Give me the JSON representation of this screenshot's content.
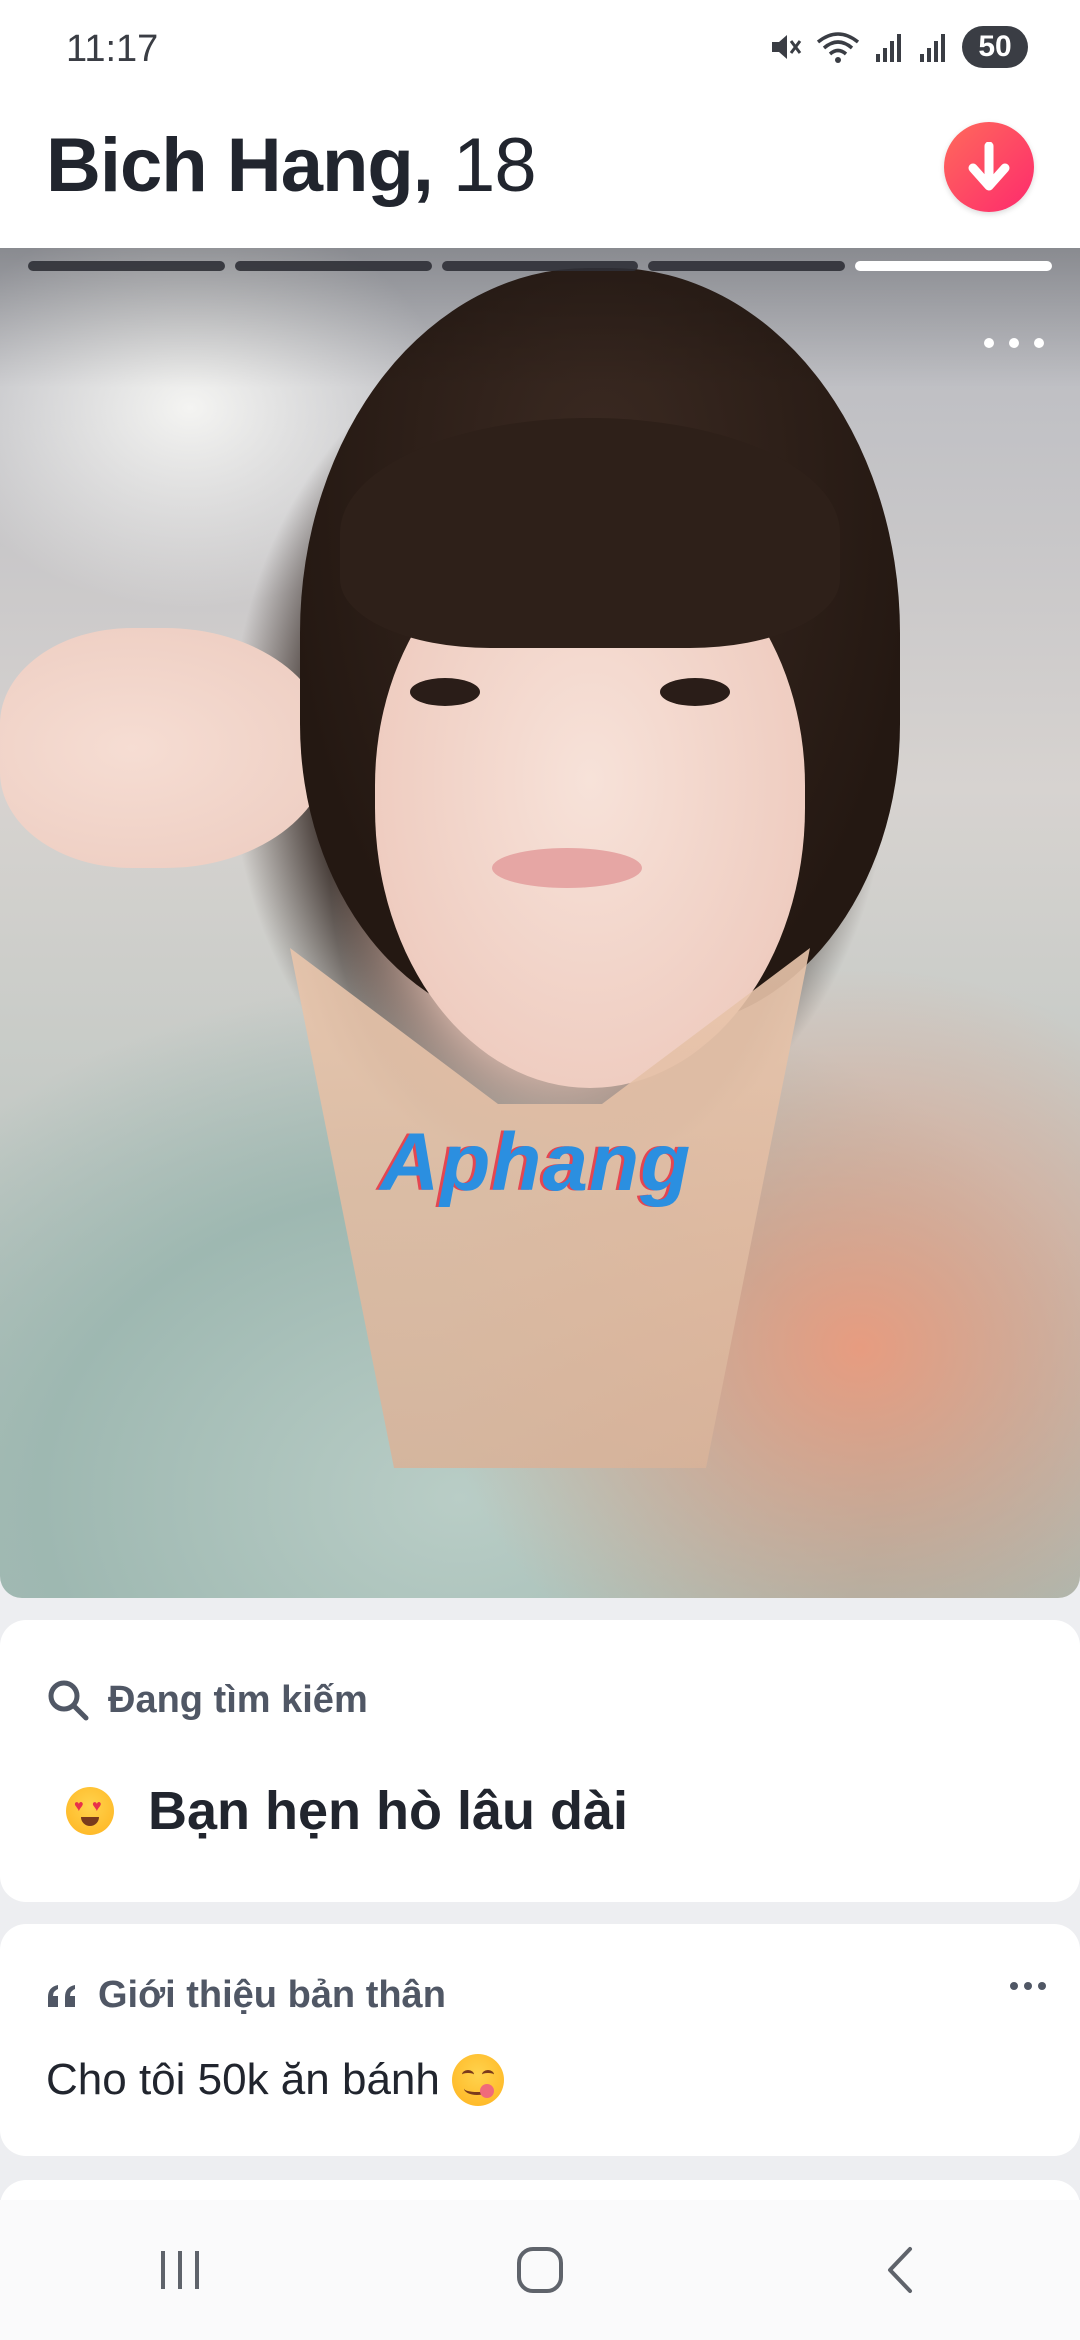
{
  "status_bar": {
    "time": "11:17",
    "battery_level": "50",
    "icons": [
      "mute-icon",
      "wifi-icon",
      "signal-icon",
      "signal-icon-2",
      "battery-icon"
    ]
  },
  "header": {
    "name": "Bich Hang,",
    "age": "18",
    "collapse_button_icon": "arrow-down-icon",
    "accent_color": "#fd2a6d"
  },
  "photo": {
    "total_photos": 5,
    "active_photo_index": 5,
    "watermark": "Aphang"
  },
  "looking_for": {
    "header": "Đang tìm kiếm",
    "icon": "search-icon",
    "value": "Bạn hẹn hò lâu dài",
    "emoji": "heart-eyes-emoji"
  },
  "about": {
    "header": "Giới thiệu bản thân",
    "icon": "quote-icon",
    "text": "Cho tôi 50k ăn bánh",
    "emoji": "yum-emoji"
  },
  "navbar": {
    "icons": [
      "recent-apps-icon",
      "home-icon",
      "back-icon"
    ]
  }
}
